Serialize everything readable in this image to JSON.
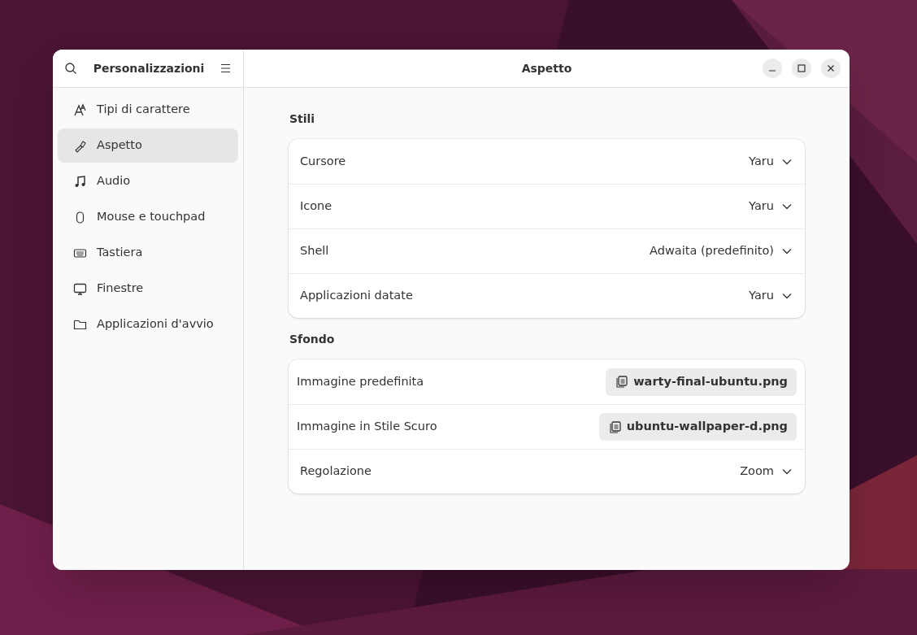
{
  "sidebar": {
    "title": "Personalizzazioni",
    "items": [
      {
        "label": "Tipi di carattere",
        "selected": false
      },
      {
        "label": "Aspetto",
        "selected": true
      },
      {
        "label": "Audio",
        "selected": false
      },
      {
        "label": "Mouse e touchpad",
        "selected": false
      },
      {
        "label": "Tastiera",
        "selected": false
      },
      {
        "label": "Finestre",
        "selected": false
      },
      {
        "label": "Applicazioni d'avvio",
        "selected": false
      }
    ]
  },
  "window": {
    "title": "Aspetto"
  },
  "sections": [
    {
      "title": "Stili",
      "rows": [
        {
          "kind": "dropdown",
          "label": "Cursore",
          "value": "Yaru"
        },
        {
          "kind": "dropdown",
          "label": "Icone",
          "value": "Yaru"
        },
        {
          "kind": "dropdown",
          "label": "Shell",
          "value": "Adwaita (predefinito)"
        },
        {
          "kind": "dropdown",
          "label": "Applicazioni datate",
          "value": "Yaru"
        }
      ]
    },
    {
      "title": "Sfondo",
      "rows": [
        {
          "kind": "file",
          "label": "Immagine predefinita",
          "value": "warty-final-ubuntu.png"
        },
        {
          "kind": "file",
          "label": "Immagine in Stile Scuro",
          "value": "ubuntu-wallpaper-d.png"
        },
        {
          "kind": "dropdown",
          "label": "Regolazione",
          "value": "Zoom"
        }
      ]
    }
  ]
}
